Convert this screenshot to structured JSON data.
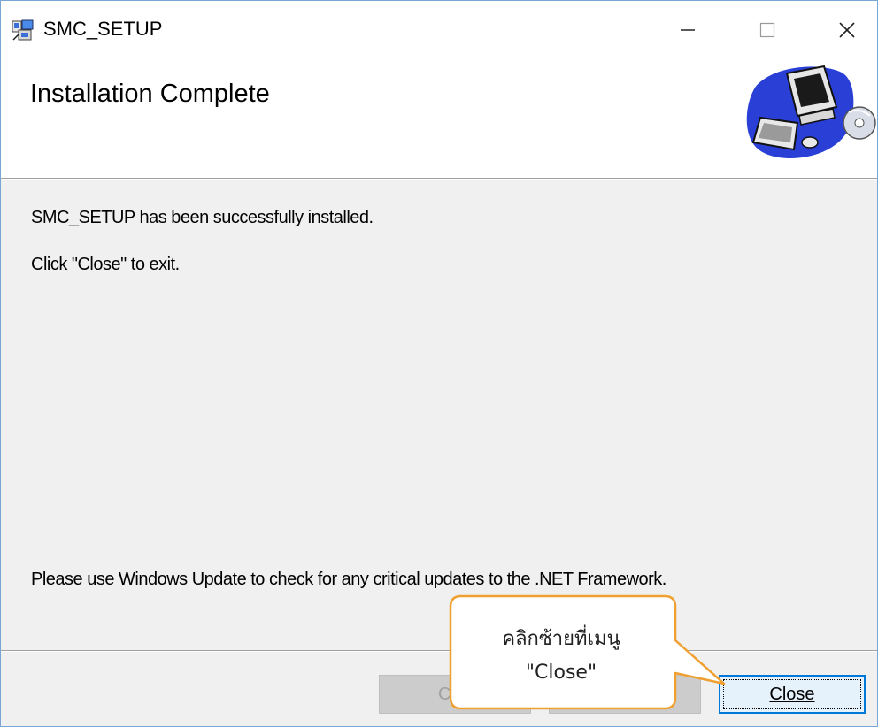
{
  "window": {
    "title": "SMC_SETUP",
    "app_icon": "installer-icon",
    "controls": {
      "minimize_icon": "minimize-icon",
      "maximize_icon": "maximize-icon",
      "close_icon": "close-icon"
    }
  },
  "header": {
    "title": "Installation Complete",
    "art_icon": "computer-with-cd-icon"
  },
  "body": {
    "success_message": "SMC_SETUP has been successfully installed.",
    "exit_hint": "Click \"Close\" to exit.",
    "update_notice": "Please use Windows Update to check for any critical updates to the .NET Framework."
  },
  "buttons": {
    "cancel": "Ca",
    "close_label": "Close"
  },
  "callout": {
    "line1": "คลิกซ้ายที่เมนู",
    "line2": "\"Close\"",
    "border_color": "#f0a030"
  },
  "colors": {
    "window_border": "#7aa6d6",
    "focus_blue": "#0078d7",
    "panel_bg": "#f0f0f0"
  }
}
